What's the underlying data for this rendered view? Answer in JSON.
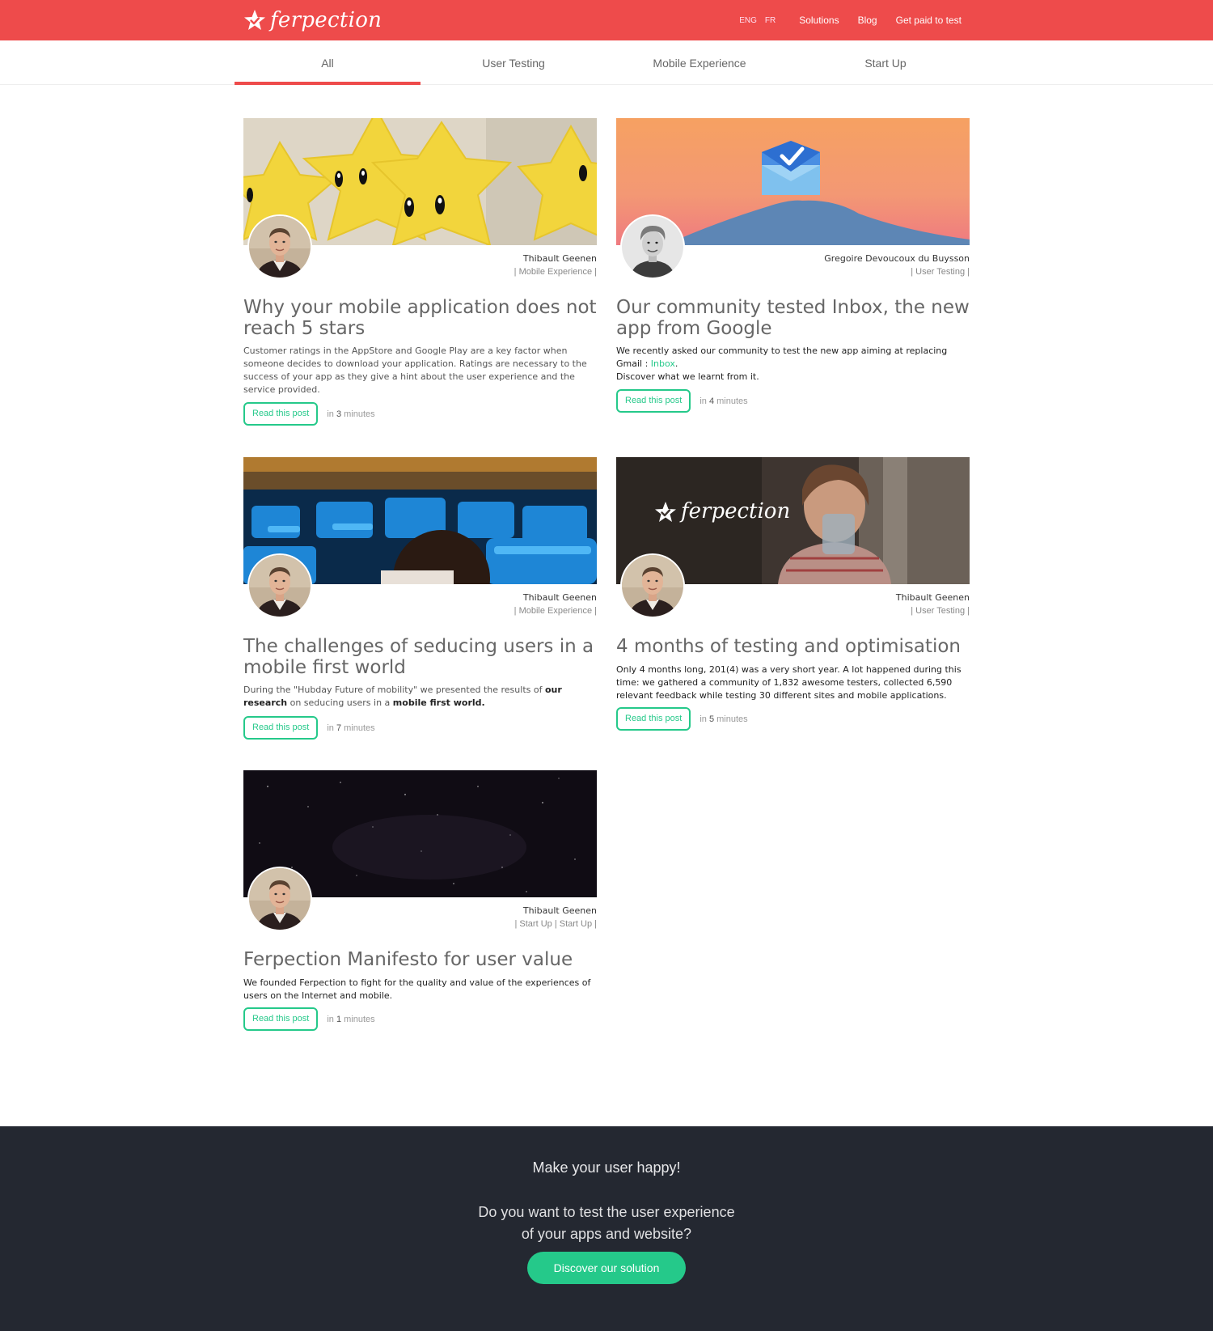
{
  "header": {
    "logo_text": "ferpection",
    "lang_en": "ENG",
    "lang_fr": "FR",
    "nav": [
      "Solutions",
      "Blog",
      "Get paid to test"
    ],
    "brand_color": "#ee4b4b"
  },
  "tabs": [
    "All",
    "User Testing",
    "Mobile Experience",
    "Start Up"
  ],
  "active_tab": "All",
  "posts": [
    {
      "author": "Thibault Geenen",
      "categories": "| Mobile Experience |",
      "title": "Why your mobile application does not reach 5 stars",
      "excerpt": "Customer ratings in the AppStore and Google Play are a key factor when someone decides to download your application. Ratings are necessary to the success of your app as they give a hint about the user experience and the service provided.",
      "button": "Read this post",
      "time_prefix": "in",
      "time_value": "3",
      "time_suffix": "minutes",
      "image": "yellow-stars"
    },
    {
      "author": "Gregoire Devoucoux du Buysson",
      "categories": "| User Testing |",
      "title": "Our community tested Inbox, the new app from Google",
      "excerpt_1": "We recently asked our community to test the new app aiming at replacing Gmail :",
      "excerpt_link": "Inbox",
      "excerpt_2": ".",
      "excerpt_3": "Discover what we learnt from it.",
      "button": "Read this post",
      "time_prefix": "in",
      "time_value": "4",
      "time_suffix": "minutes",
      "image": "inbox-envelope-sunset"
    },
    {
      "author": "Thibault Geenen",
      "categories": "| Mobile Experience |",
      "title": "The challenges of seducing users in a mobile first world",
      "excerpt_1": "During the \"Hubday Future of mobility\" we presented the results of",
      "excerpt_bold_1": "our research",
      "excerpt_2": "on seducing users in a",
      "excerpt_bold_2": "mobile first world.",
      "button": "Read this post",
      "time_prefix": "in",
      "time_value": "7",
      "time_suffix": "minutes",
      "image": "blue-seats-airport"
    },
    {
      "author": "Thibault Geenen",
      "categories": "| User Testing |",
      "title": "4 months of testing and optimisation",
      "excerpt": "Only 4 months long, 201(4) was a very short year. A lot happened during this time: we gathered a community of 1,832 awesome testers, collected 6,590 relevant feedback while testing 30 different sites and mobile applications.",
      "image_logo_text": "ferpection",
      "button": "Read this post",
      "time_prefix": "in",
      "time_value": "5",
      "time_suffix": "minutes",
      "image": "woman-phone-cafe"
    },
    {
      "author": "Thibault Geenen",
      "categories": "| Start Up | Start Up |",
      "title": "Ferpection Manifesto for user value",
      "excerpt": "We founded Ferpection to fight for the quality and value of the experiences of users on the Internet and mobile.",
      "button": "Read this post",
      "time_prefix": "in",
      "time_value": "1",
      "time_suffix": "minutes",
      "image": "starry-night-sky"
    }
  ],
  "footer": {
    "title": "Make your user happy!",
    "question_line1": "Do you want to test the user experience",
    "question_line2": "of your apps and website?",
    "cta": "Discover our solution",
    "bg_color": "#242831",
    "accent_color": "#25c98a"
  }
}
